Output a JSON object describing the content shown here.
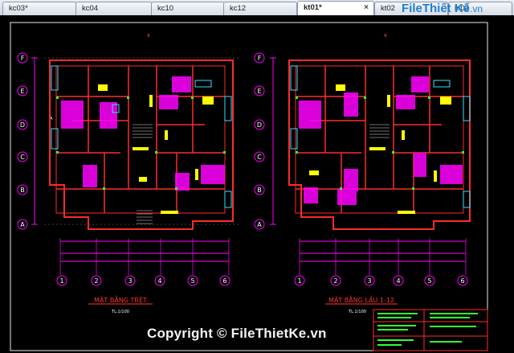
{
  "tabs": [
    {
      "label": "kc03*",
      "active": false
    },
    {
      "label": "kc04",
      "active": false
    },
    {
      "label": "kc10",
      "active": false
    },
    {
      "label": "kc12",
      "active": false
    },
    {
      "label": "kt01*",
      "active": true,
      "close": "×"
    },
    {
      "label": "kt02",
      "active": false
    },
    {
      "label": "kt03",
      "active": false
    }
  ],
  "watermark": {
    "brand": "File",
    "rest": "Thiết Kế",
    "tld": ".vn"
  },
  "drawing": {
    "left_plan": {
      "title": "MẶT BẰNG TRỆT",
      "scale": "TL:1/100"
    },
    "right_plan": {
      "title": "MẶT BẰNG LẦU 1-12",
      "scale": "TL:1/100"
    },
    "row_axes": [
      "F",
      "E",
      "D",
      "C",
      "B",
      "A"
    ],
    "column_axes": [
      "1",
      "2",
      "3",
      "4",
      "5",
      "6"
    ],
    "top_marker": "B",
    "side_marker": "A"
  },
  "copyright": "Copyright © FileThietKe.vn",
  "colors": {
    "background": "#000000",
    "walls": "#ff2a2a",
    "fill": "#ff00ff",
    "accent": "#ffff00",
    "lines": "#ff00ff",
    "cyan": "#35e0ff",
    "green": "#33ff33"
  }
}
